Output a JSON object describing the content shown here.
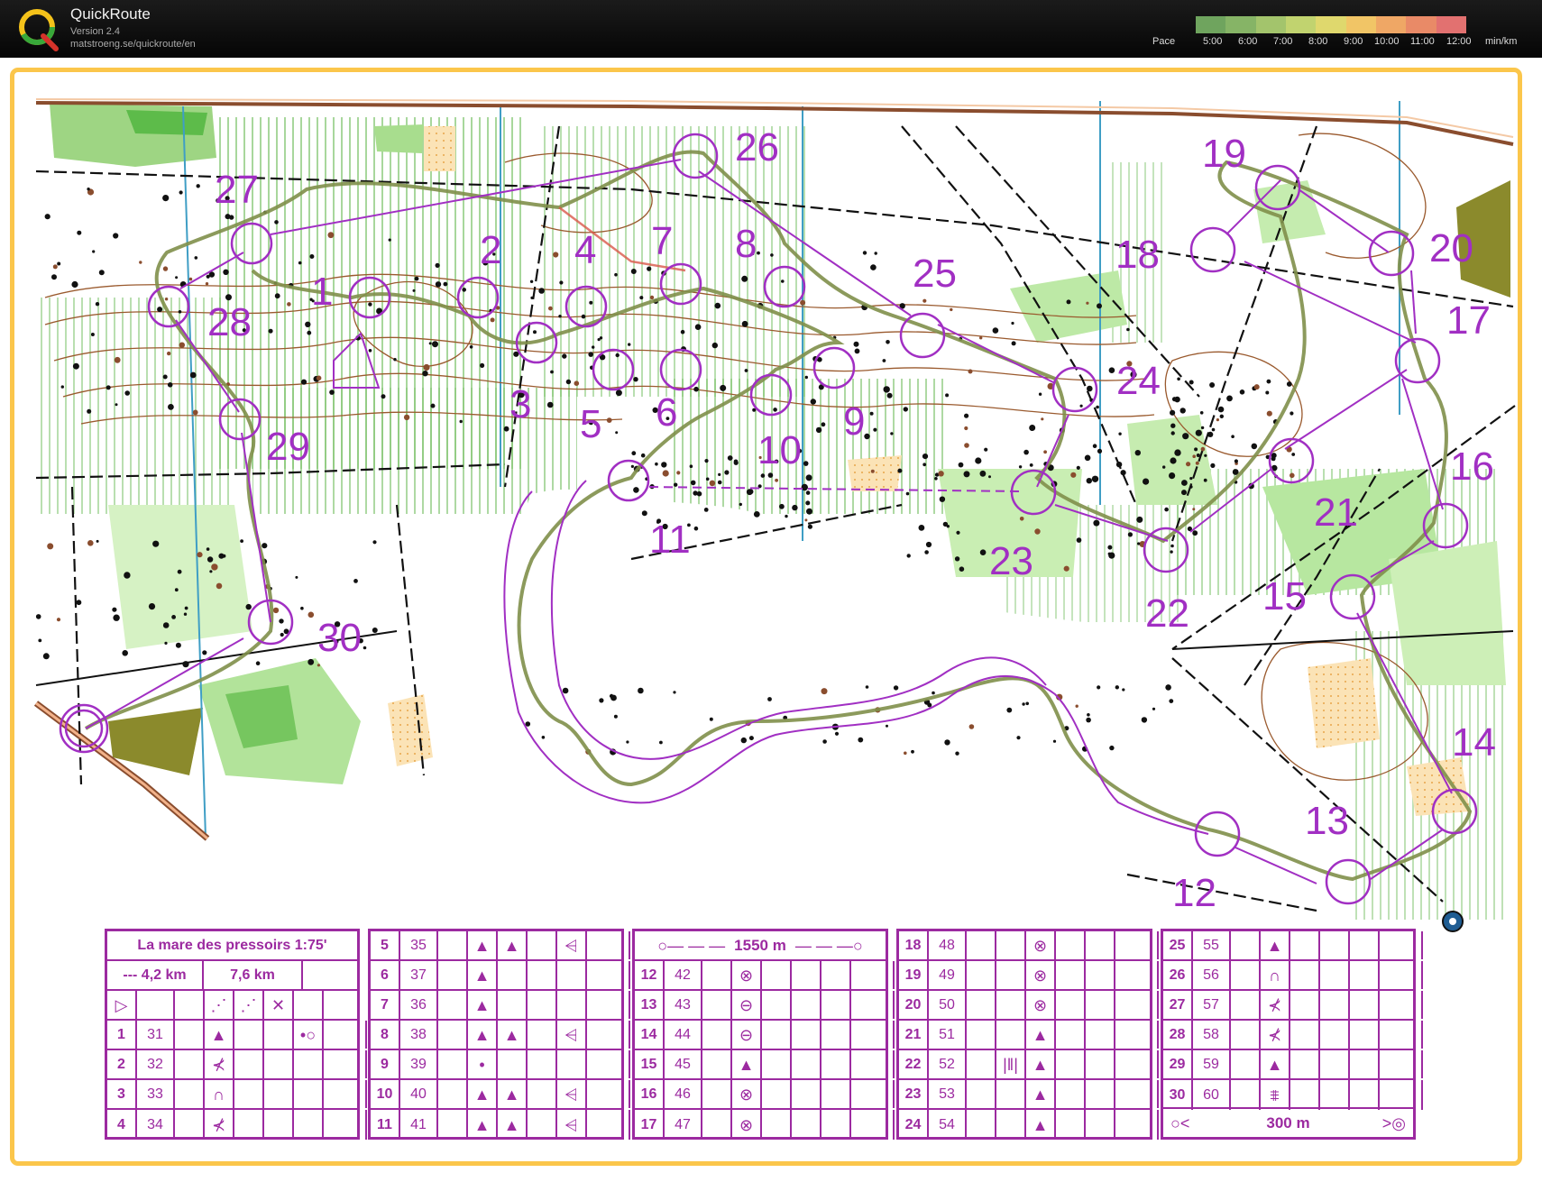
{
  "app": {
    "title": "QuickRoute",
    "version": "Version 2.4",
    "url": "matstroeng.se/quickroute/en"
  },
  "pace_legend": {
    "label": "Pace",
    "ticks": [
      "5:00",
      "6:00",
      "7:00",
      "8:00",
      "9:00",
      "10:00",
      "11:00",
      "12:00"
    ],
    "unit": "min/km",
    "gradient_colors": [
      "#6fa45e",
      "#86b466",
      "#a3c46c",
      "#c1d36f",
      "#dfd86d",
      "#f1c566",
      "#efa765",
      "#e98a67",
      "#e27170"
    ]
  },
  "map": {
    "route_color": "#7f8f4a",
    "course_color": "#a12fc3",
    "control_labels": [
      "1",
      "2",
      "3",
      "4",
      "5",
      "6",
      "7",
      "8",
      "9",
      "10",
      "11",
      "12",
      "13",
      "14",
      "15",
      "16",
      "17",
      "18",
      "19",
      "20",
      "21",
      "22",
      "23",
      "24",
      "25",
      "26",
      "27",
      "28",
      "29",
      "30"
    ]
  },
  "control_description": {
    "title": "La mare des pressoirs 1:75'",
    "length_short": "--- 4,2 km",
    "length_long": "7,6 km",
    "marked_route_1": "1550 m",
    "finish_distance": "300 m",
    "columns": [
      [
        {
          "num": "1",
          "code": "31",
          "symbols": [
            "▲",
            "",
            "",
            "•○"
          ]
        },
        {
          "num": "2",
          "code": "32",
          "symbols": [
            "⊀",
            "",
            "",
            ""
          ]
        },
        {
          "num": "3",
          "code": "33",
          "symbols": [
            "∩",
            "",
            "",
            ""
          ]
        },
        {
          "num": "4",
          "code": "34",
          "symbols": [
            "⊀",
            "",
            "",
            ""
          ]
        }
      ],
      [
        {
          "num": "5",
          "code": "35",
          "symbols": [
            "▲",
            "▲",
            "",
            "⩤"
          ]
        },
        {
          "num": "6",
          "code": "37",
          "symbols": [
            "▲",
            "",
            "",
            ""
          ]
        },
        {
          "num": "7",
          "code": "36",
          "symbols": [
            "▲",
            "",
            "",
            ""
          ]
        },
        {
          "num": "8",
          "code": "38",
          "symbols": [
            "▲",
            "▲",
            "",
            "⩤"
          ]
        },
        {
          "num": "9",
          "code": "39",
          "symbols": [
            "•",
            "",
            "",
            ""
          ]
        },
        {
          "num": "10",
          "code": "40",
          "symbols": [
            "▲",
            "▲",
            "",
            "⩤"
          ]
        },
        {
          "num": "11",
          "code": "41",
          "symbols": [
            "▲",
            "▲",
            "",
            "⩤"
          ]
        }
      ],
      [
        {
          "num": "12",
          "code": "42",
          "symbols": [
            "⊗",
            "",
            "",
            ""
          ]
        },
        {
          "num": "13",
          "code": "43",
          "symbols": [
            "⊖",
            "",
            "",
            ""
          ]
        },
        {
          "num": "14",
          "code": "44",
          "symbols": [
            "⊖",
            "",
            "",
            ""
          ]
        },
        {
          "num": "15",
          "code": "45",
          "symbols": [
            "▲",
            "",
            "",
            ""
          ]
        },
        {
          "num": "16",
          "code": "46",
          "symbols": [
            "⊗",
            "",
            "",
            ""
          ]
        },
        {
          "num": "17",
          "code": "47",
          "symbols": [
            "⊗",
            "",
            "",
            ""
          ]
        }
      ],
      [
        {
          "num": "18",
          "code": "48",
          "symbols": [
            "",
            "⊗",
            "",
            ""
          ]
        },
        {
          "num": "19",
          "code": "49",
          "symbols": [
            "",
            "⊗",
            "",
            ""
          ]
        },
        {
          "num": "20",
          "code": "50",
          "symbols": [
            "",
            "⊗",
            "",
            ""
          ]
        },
        {
          "num": "21",
          "code": "51",
          "symbols": [
            "",
            "▲",
            "",
            ""
          ]
        },
        {
          "num": "22",
          "code": "52",
          "symbols": [
            "|‖|",
            "▲",
            "",
            ""
          ]
        },
        {
          "num": "23",
          "code": "53",
          "symbols": [
            "",
            "▲",
            "",
            ""
          ]
        },
        {
          "num": "24",
          "code": "54",
          "symbols": [
            "",
            "▲",
            "",
            ""
          ]
        }
      ],
      [
        {
          "num": "25",
          "code": "55",
          "symbols": [
            "▲",
            "",
            "",
            ""
          ]
        },
        {
          "num": "26",
          "code": "56",
          "symbols": [
            "∩",
            "",
            "",
            ""
          ]
        },
        {
          "num": "27",
          "code": "57",
          "symbols": [
            "⊀",
            "",
            "",
            ""
          ]
        },
        {
          "num": "28",
          "code": "58",
          "symbols": [
            "⊀",
            "",
            "",
            ""
          ]
        },
        {
          "num": "29",
          "code": "59",
          "symbols": [
            "▲",
            "",
            "",
            ""
          ]
        },
        {
          "num": "30",
          "code": "60",
          "symbols": [
            "⩨",
            "",
            "",
            ""
          ]
        }
      ]
    ]
  }
}
